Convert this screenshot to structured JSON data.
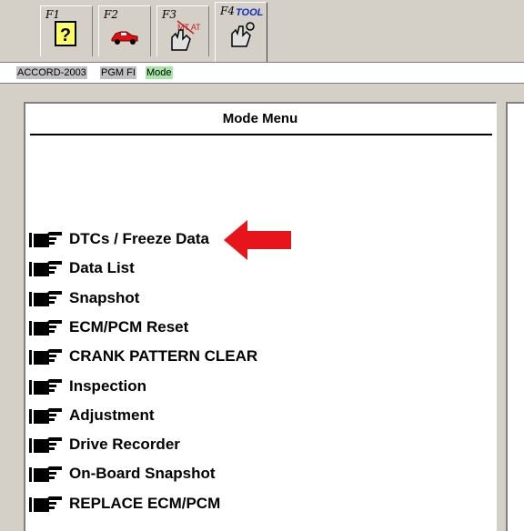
{
  "toolbar": {
    "tabs": [
      {
        "key": "F1"
      },
      {
        "key": "F2"
      },
      {
        "key": "F3"
      },
      {
        "key": "F4",
        "icon_text": "TOOL"
      }
    ]
  },
  "status": {
    "model": "ACCORD-2003",
    "system": "PGM FI",
    "mode": "Mode"
  },
  "panel": {
    "title": "Mode Menu",
    "items": [
      {
        "label": "DTCs / Freeze Data"
      },
      {
        "label": "Data List"
      },
      {
        "label": "Snapshot"
      },
      {
        "label": "ECM/PCM Reset"
      },
      {
        "label": "CRANK PATTERN CLEAR"
      },
      {
        "label": "Inspection"
      },
      {
        "label": "Adjustment"
      },
      {
        "label": "Drive Recorder"
      },
      {
        "label": "On-Board Snapshot"
      },
      {
        "label": "REPLACE ECM/PCM"
      }
    ]
  },
  "colors": {
    "arrow": "#e8141b",
    "mode_chip": "#a6e6a6",
    "chip": "#c0c0c0"
  }
}
